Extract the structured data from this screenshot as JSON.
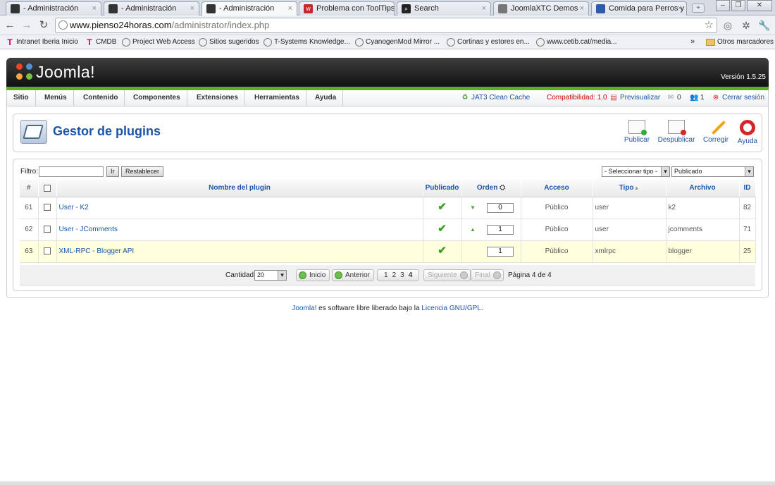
{
  "browser": {
    "tabs": [
      {
        "title": "- Administración",
        "icon": "joomla-icon",
        "icon_color": "#333333",
        "active": false
      },
      {
        "title": "- Administración",
        "icon": "joomla-icon",
        "icon_color": "#333333",
        "active": false
      },
      {
        "title": "- Administración",
        "icon": "joomla-icon",
        "icon_color": "#333333",
        "active": true
      },
      {
        "title": "Problema con ToolTips (",
        "icon": "w-icon",
        "icon_color": "#c8262a",
        "active": false
      },
      {
        "title": "Search",
        "icon": "search-icon",
        "icon_color": "#222222",
        "active": false
      },
      {
        "title": "JoomlaXTC Demos",
        "icon": "globe-icon",
        "icon_color": "#777777",
        "active": false
      },
      {
        "title": "Comida para Perros y G",
        "icon": "globe-icon",
        "icon_color": "#2a5aa8",
        "active": false
      }
    ],
    "address": {
      "host": "www.pienso24horas.com",
      "path": "/administrator/index.php"
    },
    "bookmarks": [
      {
        "label": "Intranet Iberia Inicio",
        "icon": "t-icon"
      },
      {
        "label": "CMDB",
        "icon": "t-icon"
      },
      {
        "label": "Project Web Access",
        "icon": "globe-icon"
      },
      {
        "label": "Sitios sugeridos",
        "icon": "globe-icon"
      },
      {
        "label": "T-Systems Knowledge...",
        "icon": "globe-icon"
      },
      {
        "label": "CyanogenMod Mirror ...",
        "icon": "globe-icon"
      },
      {
        "label": "Cortinas y estores en...",
        "icon": "globe-icon"
      },
      {
        "label": "www.cetib.cat/media...",
        "icon": "globe-icon"
      }
    ],
    "more_label": "»",
    "other_bookmarks": "Otros marcadores"
  },
  "header": {
    "logo_text": "Joomla!",
    "version": "Versión 1.5.25"
  },
  "menu": {
    "items": [
      "Sitio",
      "Menús",
      "Contenido",
      "Componentes",
      "Extensiones",
      "Herramientas",
      "Ayuda"
    ],
    "cache": "JAT3 Clean Cache",
    "compat": "Compatibilidad: 1.0",
    "preview": "Previsualizar",
    "messages": "0",
    "users": "1",
    "logout": "Cerrar sesión"
  },
  "toolbar": {
    "title": "Gestor de plugins",
    "buttons": [
      "Publicar",
      "Despublicar",
      "Corregir",
      "Ayuda"
    ]
  },
  "filter": {
    "label": "Filtro:",
    "value": "",
    "go": "Ir",
    "reset": "Restablecer",
    "type_select": "- Seleccionar tipo -",
    "state_select": "Publicado"
  },
  "table": {
    "headers": [
      "#",
      "",
      "Nombre del plugin",
      "Publicado",
      "Orden",
      "Acceso",
      "Tipo",
      "Archivo",
      "ID"
    ],
    "rows": [
      {
        "num": "61",
        "name": "User - K2",
        "published": true,
        "order": "0",
        "arrow_up": false,
        "arrow_down": true,
        "access": "Público",
        "type": "user",
        "file": "k2",
        "id": "82"
      },
      {
        "num": "62",
        "name": "User - JComments",
        "published": true,
        "order": "1",
        "arrow_up": true,
        "arrow_down": false,
        "access": "Público",
        "type": "user",
        "file": "jcomments",
        "id": "71"
      },
      {
        "num": "63",
        "name": "XML-RPC - Blogger API",
        "published": true,
        "order": "1",
        "arrow_up": false,
        "arrow_down": false,
        "access": "Público",
        "type": "xmlrpc",
        "file": "blogger",
        "id": "25"
      }
    ]
  },
  "pager": {
    "qty_label": "Cantidad:",
    "qty_value": "20",
    "start": "Inicio",
    "prev": "Anterior",
    "pages": [
      "1",
      "2",
      "3",
      "4"
    ],
    "current_page": "4",
    "next": "Siguiente",
    "last": "Final",
    "page_info": "Página 4 de 4"
  },
  "footer": {
    "brand": "Joomla!",
    "text": " es software libre liberado bajo la ",
    "license": "Licencia GNU/GPL",
    "end": "."
  }
}
